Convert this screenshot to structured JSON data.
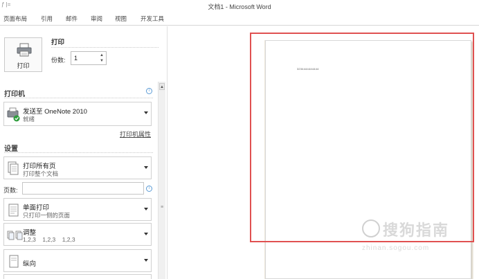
{
  "window": {
    "title": "文档1 - Microsoft Word",
    "quick_access": "ƒ |="
  },
  "ribbon": {
    "tabs": [
      "页面布局",
      "引用",
      "邮件",
      "审阅",
      "视图",
      "开发工具"
    ]
  },
  "print_panel": {
    "print_button_label": "打印",
    "print_heading": "打印",
    "copies_label": "份数:",
    "copies_value": "1"
  },
  "printer": {
    "section_title": "打印机",
    "selected_name": "发送至 OneNote 2010",
    "status": "就绪",
    "properties_link": "打印机属性"
  },
  "settings": {
    "section_title": "设置",
    "print_range": {
      "main": "打印所有页",
      "sub": "打印整个文档"
    },
    "pages_label": "页数:",
    "pages_value": "",
    "sides": {
      "main": "单面打印",
      "sub": "只打印一侧的页面"
    },
    "collation": {
      "main": "调整",
      "sub": "1,2,3    1,2,3    1,2,3"
    },
    "orientation": {
      "main": "纵向"
    }
  },
  "preview": {
    "page_text": "3234444444444"
  },
  "watermark": {
    "main": "搜狗指南",
    "sub": "zhinan.sogou.com"
  }
}
